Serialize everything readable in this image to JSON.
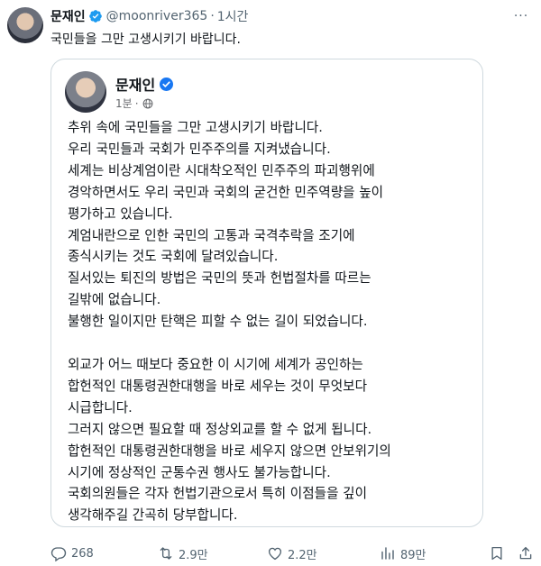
{
  "tweet": {
    "author_name": "문재인",
    "handle": "@moonriver365",
    "separator": "·",
    "time": "1시간",
    "more_label": "···",
    "text": "국민들을 그만 고생시키기 바랍니다."
  },
  "embedded_post": {
    "author_name": "문재인",
    "time": "1분",
    "separator": "·",
    "lines": [
      "추위 속에 국민들을 그만 고생시키기 바랍니다.",
      "우리 국민들과 국회가 민주주의를 지켜냈습니다.",
      "세계는 비상계엄이란 시대착오적인 민주주의 파괴행위에",
      "경악하면서도 우리 국민과 국회의 굳건한 민주역량을 높이",
      "평가하고 있습니다.",
      "계엄내란으로 인한 국민의 고통과 국격추락을 조기에",
      "종식시키는 것도 국회에 달려있습니다.",
      "질서있는 퇴진의 방법은 국민의 뜻과 헌법절차를 따르는",
      "길밖에 없습니다.",
      "불행한 일이지만 탄핵은 피할 수 없는 길이 되었습니다.",
      "",
      "외교가 어느 때보다 중요한 이 시기에 세계가 공인하는",
      "합헌적인 대통령권한대행을 바로 세우는 것이 무엇보다",
      "시급합니다.",
      "그러지 않으면 필요할 때 정상외교를 할 수 없게 됩니다.",
      "합헌적인 대통령권한대행을 바로 세우지 않으면 안보위기의",
      "시기에 정상적인 군통수권 행사도 불가능합니다.",
      "국회의원들은 각자 헌법기관으로서 특히 이점들을 깊이",
      "생각해주길 간곡히 당부합니다."
    ]
  },
  "actions": {
    "replies": "268",
    "reposts": "2.9만",
    "likes": "2.2만",
    "views": "89만"
  },
  "colors": {
    "verified_blue": "#1d9bf0",
    "fb_verified_blue": "#1877f2",
    "secondary_text": "#536471",
    "border": "#cfd9de"
  }
}
